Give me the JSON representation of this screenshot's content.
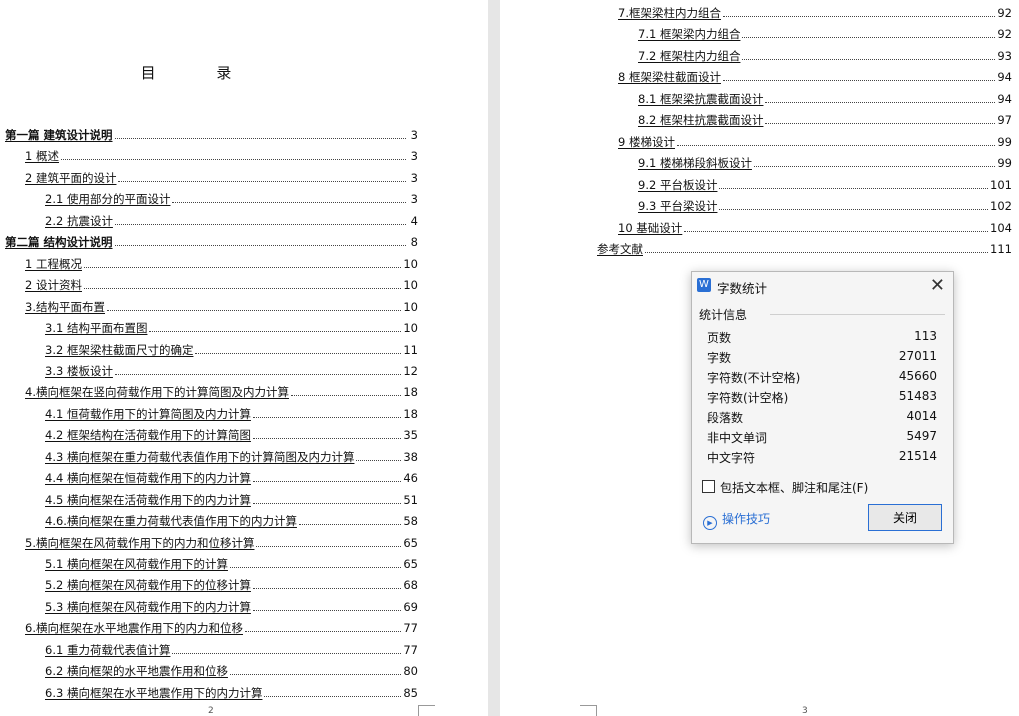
{
  "left_page": {
    "title": "目 录",
    "page_number": "2",
    "toc": [
      {
        "text": "第一篇  建筑设计说明",
        "page": "3",
        "level": 0,
        "bold": true
      },
      {
        "text": "1 概述",
        "page": "3",
        "level": 1
      },
      {
        "text": "2 建筑平面的设计",
        "page": "3",
        "level": 1
      },
      {
        "text": "2.1 使用部分的平面设计",
        "page": "3",
        "level": 2
      },
      {
        "text": "2.2 抗震设计",
        "page": "4",
        "level": 2
      },
      {
        "text": "第二篇  结构设计说明",
        "page": "8",
        "level": 0,
        "bold": true
      },
      {
        "text": "1 工程概况",
        "page": "10",
        "level": 1
      },
      {
        "text": "2 设计资料",
        "page": "10",
        "level": 1
      },
      {
        "text": "3.结构平面布置",
        "page": "10",
        "level": 1
      },
      {
        "text": "3.1 结构平面布置图",
        "page": "10",
        "level": 2
      },
      {
        "text": "3.2 框架梁柱截面尺寸的确定",
        "page": "11",
        "level": 2
      },
      {
        "text": "3.3 楼板设计",
        "page": "12",
        "level": 2
      },
      {
        "text": "4.横向框架在竖向荷载作用下的计算简图及内力计算",
        "page": "18",
        "level": 1
      },
      {
        "text": "4.1 恒荷载作用下的计算简图及内力计算",
        "page": "18",
        "level": 2
      },
      {
        "text": "4.2 框架结构在活荷载作用下的计算简图",
        "page": "35",
        "level": 2
      },
      {
        "text": "4.3 横向框架在重力荷载代表值作用下的计算简图及内力计算",
        "page": "38",
        "level": 2
      },
      {
        "text": "4.4 横向框架在恒荷载作用下的内力计算",
        "page": "46",
        "level": 2
      },
      {
        "text": "4.5 横向框架在活荷载作用下的内力计算",
        "page": "51",
        "level": 2
      },
      {
        "text": "4.6.横向框架在重力荷载代表值作用下的内力计算",
        "page": "58",
        "level": 2
      },
      {
        "text": "5.横向框架在风荷载作用下的内力和位移计算",
        "page": "65",
        "level": 1
      },
      {
        "text": "5.1 横向框架在风荷载作用下的计算",
        "page": "65",
        "level": 2
      },
      {
        "text": "5.2 横向框架在风荷载作用下的位移计算",
        "page": "68",
        "level": 2
      },
      {
        "text": "5.3 横向框架在风荷载作用下的内力计算",
        "page": "69",
        "level": 2
      },
      {
        "text": "6.横向框架在水平地震作用下的内力和位移",
        "page": "77",
        "level": 1
      },
      {
        "text": "6.1 重力荷载代表值计算",
        "page": "77",
        "level": 2
      },
      {
        "text": "6.2 横向框架的水平地震作用和位移",
        "page": "80",
        "level": 2
      },
      {
        "text": "6.3 横向框架在水平地震作用下的内力计算",
        "page": "85",
        "level": 2
      }
    ]
  },
  "right_page": {
    "page_number": "3",
    "toc": [
      {
        "text": "7.框架梁柱内力组合",
        "page": "92",
        "level": 1
      },
      {
        "text": "7.1 框架梁内力组合",
        "page": "92",
        "level": 2
      },
      {
        "text": "7.2 框架柱内力组合",
        "page": "93",
        "level": 2
      },
      {
        "text": "8 框架梁柱截面设计",
        "page": "94",
        "level": 1
      },
      {
        "text": "8.1 框架梁抗震截面设计",
        "page": "94",
        "level": 2
      },
      {
        "text": "8.2 框架柱抗震截面设计",
        "page": "97",
        "level": 2
      },
      {
        "text": "9 楼梯设计",
        "page": "99",
        "level": 1
      },
      {
        "text": "9.1 楼梯梯段斜板设计",
        "page": "99",
        "level": 2
      },
      {
        "text": "9.2 平台板设计",
        "page": "101",
        "level": 2
      },
      {
        "text": "9.3 平台梁设计",
        "page": "102",
        "level": 2
      },
      {
        "text": "10 基础设计",
        "page": "104",
        "level": 1
      },
      {
        "text": "参考文献",
        "page": "111",
        "level": 0
      }
    ]
  },
  "dialog": {
    "title": "字数统计",
    "app_icon_letter": "W",
    "close_glyph": "✕",
    "section_label": "统计信息",
    "stats": [
      {
        "label": "页数",
        "value": "113"
      },
      {
        "label": "字数",
        "value": "27011"
      },
      {
        "label": "字符数(不计空格)",
        "value": "45660"
      },
      {
        "label": "字符数(计空格)",
        "value": "51483"
      },
      {
        "label": "段落数",
        "value": "4014"
      },
      {
        "label": "非中文单词",
        "value": "5497"
      },
      {
        "label": "中文字符",
        "value": "21514"
      }
    ],
    "checkbox_label": "包括文本框、脚注和尾注(F)",
    "checkbox_checked": false,
    "tips_label": "操作技巧",
    "close_button": "关闭",
    "accent_color": "#2a6fd4"
  }
}
